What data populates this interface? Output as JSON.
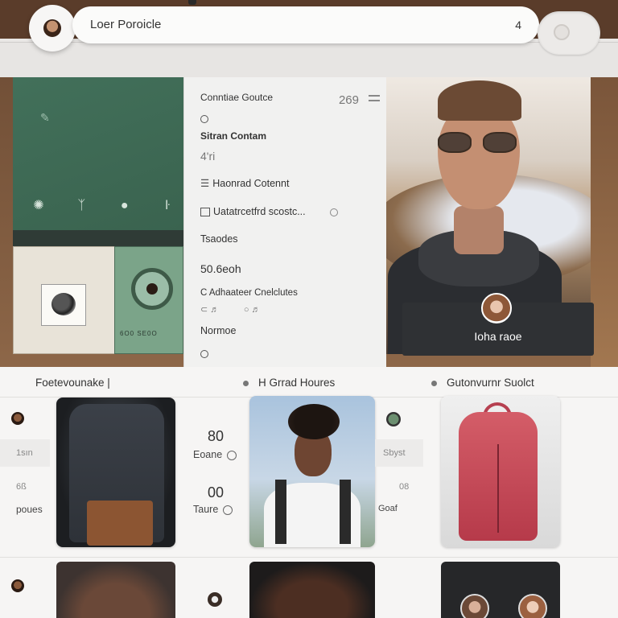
{
  "header": {
    "title": "Loer Poroicle",
    "count": "4"
  },
  "panel": {
    "heading": "Conntiae Goutce",
    "number": "269",
    "section_title": "Sitran Contam",
    "section_value": "4'ri",
    "item1": "Haonrad Cotennt",
    "item2": "Uatatrcetfrd scostc...",
    "label1": "Tsaodes",
    "value1": "50.6eoh",
    "label2": "C Adhaateer Cnelclutes",
    "label3": "Normoe"
  },
  "profile": {
    "name": "Ioha raoe"
  },
  "green": {
    "device_label": "6O0 SE0O"
  },
  "tabs": [
    {
      "label": "Foetevounake |"
    },
    {
      "label": "H Grrad Houres"
    },
    {
      "label": "Gutonvurnr Suolct"
    }
  ],
  "row1": {
    "left_top": "1sın",
    "left_mid": "6ß",
    "left_bottom": "poues",
    "stat1_num": "80",
    "stat1_label": "Eoane",
    "stat2_num": "00",
    "stat2_label": "Taure",
    "right_top": "Sbyst",
    "right_mid": "08",
    "right_bottom": "Goaf"
  },
  "icons": {
    "avatar": "user-avatar-icon",
    "menu": "menu-icon",
    "circle": "circle-icon"
  },
  "colors": {
    "green_panel": "#42705a",
    "name_card": "#2f3134",
    "red_bag": "#c84a58"
  }
}
